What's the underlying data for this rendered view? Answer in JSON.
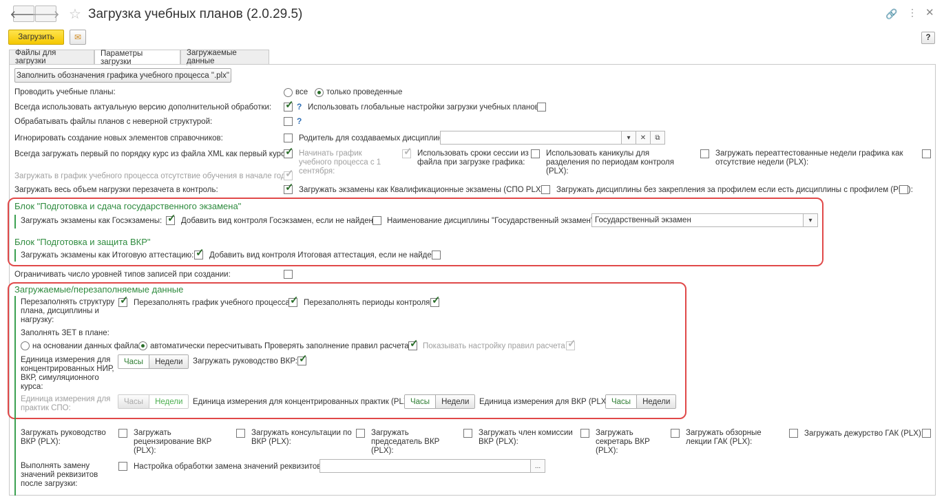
{
  "window": {
    "title": "Загрузка учебных планов (2.0.29.5)"
  },
  "toolbar": {
    "load_label": "Загрузить",
    "help_label": "?"
  },
  "tabs": [
    "Файлы для загрузки",
    "Параметры загрузки",
    "Загружаемые данные"
  ],
  "fill_button": "Заполнить обозначения графика учебного процесса \".plx\"",
  "rows": {
    "post": "Проводить учебные планы:",
    "post_all": "все",
    "post_only": "только проведенные",
    "use_actual": "Всегда использовать актуальную версию дополнительной обработки:",
    "use_global": "Использовать глобальные настройки загрузки учебных планов:",
    "wrong_struct": "Обрабатывать файлы планов с неверной структурой:",
    "ignore_new": "Игнорировать создание новых элементов справочников:",
    "parent": "Родитель для создаваемых дисциплин:",
    "first_course": "Всегда загружать первый по порядку курс из файла XML как первый курс:",
    "start_sept": "Начинать график учебного процесса с 1 сентября:",
    "session_terms": "Использовать сроки сессии из файла при загрузке графика:",
    "holidays": "Использовать каникулы для разделения по периодам контроля (PLX):",
    "reattested": "Загружать переаттестованные недели графика как отсутствие недели (PLX):",
    "absence": "Загружать в график учебного процесса отсутствие обучения в начале года:",
    "all_load": "Загружать весь объем нагрузки перезачета в контроль:",
    "qual_exams": "Загружать экзамены как Квалификационные экзамены (СПО PLX):",
    "disc_no_profile": "Загружать дисциплины без закрепления за профилем если есть дисциплины с профилем (PLX):",
    "limit_levels": "Ограничивать число уровней типов записей при создании:"
  },
  "gos": {
    "title": "Блок \"Подготовка и сдача государственного экзамена\"",
    "load_as": "Загружать экзамены как Госэкзамены:",
    "add_kind": "Добавить вид контроля Госэкзамен, если не найден:",
    "disc_name": "Наименование дисциплины \"Государственный экзамен\":",
    "disc_value": "Государственный экзамен"
  },
  "vkr": {
    "title": "Блок \"Подготовка и защита ВКР\"",
    "load_as": "Загружать экзамены как Итоговую аттестацию:",
    "add_kind": "Добавить вид контроля Итоговая аттестация, если не найден:"
  },
  "reload": {
    "title": "Загружаемые/перезаполняемые данные",
    "refill_struct": "Перезаполнять структуру плана, дисциплины и нагрузку:",
    "refill_schedule": "Перезаполнять график учебного процесса:",
    "refill_periods": "Перезаполнять периоды контроля:",
    "zet": "Заполнять ЗЕТ в плане:",
    "zet_file": "на основании данных файла",
    "zet_auto": "автоматически пересчитывать",
    "check_rules": "Проверять заполнение правил расчета:",
    "show_rules": "Показывать настройку правил расчета:",
    "unit_nir": "Единица измерения для концентрированных НИР, ВКР, симуляционного курса:",
    "hours": "Часы",
    "weeks": "Недели",
    "load_vkr_lead": "Загружать руководство ВКР:",
    "unit_spo": "Единица измерения для практик СПО:",
    "unit_conc": "Единица измерения для концентрированных практик (PLX):",
    "unit_vkr": "Единица измерения для ВКР (PLX):"
  },
  "bottom": {
    "lead": "Загружать руководство ВКР (PLX):",
    "review": "Загружать рецензирование ВКР (PLX):",
    "consult": "Загружать консультации по ВКР (PLX):",
    "chair": "Загружать председатель ВКР (PLX):",
    "member": "Загружать член комиссии ВКР (PLX):",
    "secretary": "Загружать секретарь ВКР (PLX):",
    "lectures": "Загружать обзорные лекции ГАК (PLX):",
    "duty": "Загружать дежурство ГАК (PLX):",
    "replace": "Выполнять замену значений реквизитов после загрузки:",
    "replace_setup": "Настройка обработки замена значений реквизитов:",
    "ellipsis": "..."
  }
}
